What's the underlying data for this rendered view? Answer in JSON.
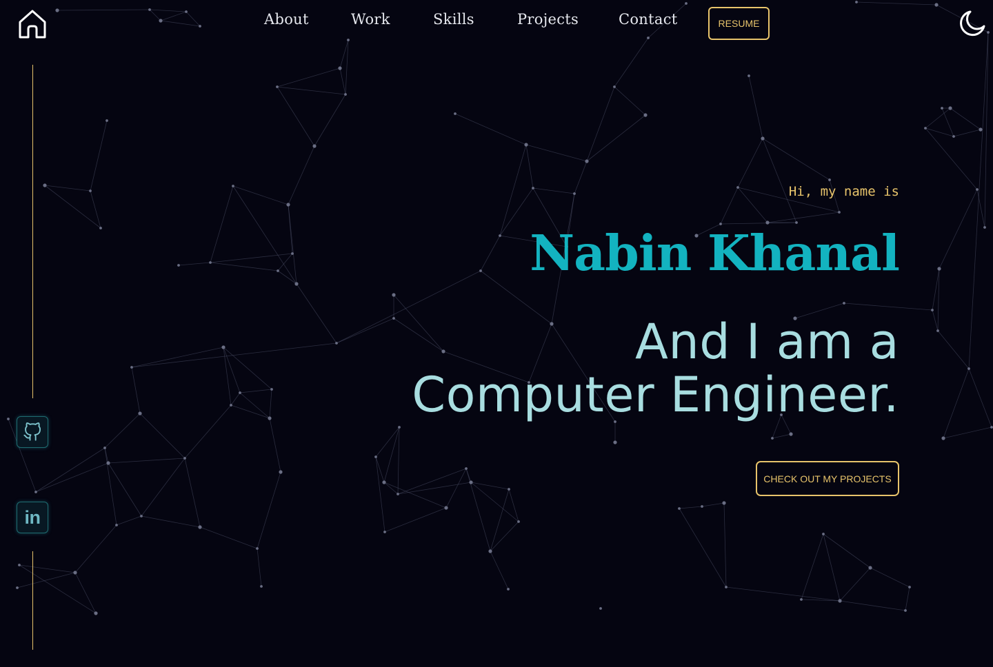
{
  "colors": {
    "background": "#050511",
    "accent_gold": "#e8c46b",
    "name_teal": "#13b3c0",
    "tagline_cyan": "#a8dde0",
    "nav_text": "#e6e8ee"
  },
  "header": {
    "home_icon": "home-icon",
    "nav": [
      "About",
      "Work",
      "Skills",
      "Projects",
      "Contact"
    ],
    "resume_label": "RESUME",
    "theme_icon": "moon-icon"
  },
  "sidebar": {
    "socials": [
      {
        "name": "GitHub",
        "icon": "github-icon"
      },
      {
        "name": "LinkedIn",
        "icon": "linkedin-icon",
        "glyph": "in"
      }
    ]
  },
  "hero": {
    "greeting": "Hi, my name is",
    "name": "Nabin Khanal",
    "tagline_line1": "And I am a",
    "tagline_line2": "Computer Engineer.",
    "cta_label": "CHECK OUT MY PROJECTS"
  }
}
